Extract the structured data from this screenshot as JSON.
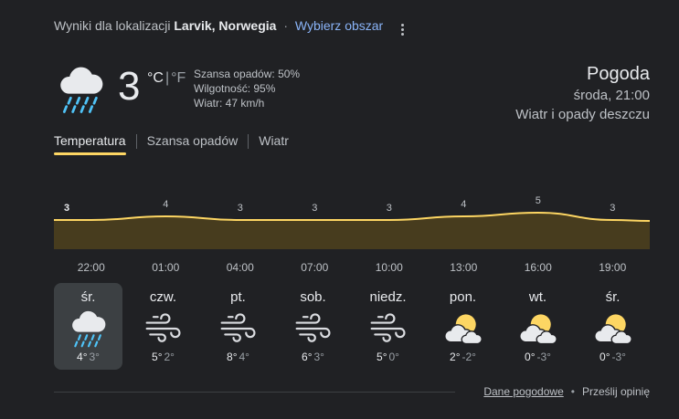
{
  "header": {
    "prefix": "Wyniki dla lokalizacji",
    "location": "Larvik, Norwegia",
    "separator": "·",
    "choose_area": "Wybierz obszar"
  },
  "current": {
    "icon": "rain-cloud-icon",
    "temperature": "3",
    "unit_c": "°C",
    "unit_sep": "|",
    "unit_f": "°F",
    "precip": "Szansa opadów: 50%",
    "humidity": "Wilgotność: 95%",
    "wind": "Wiatr: 47 km/h"
  },
  "summary": {
    "title": "Pogoda",
    "time": "środa, 21:00",
    "condition": "Wiatr i opady deszczu"
  },
  "tabs": [
    {
      "label": "Temperatura",
      "active": true
    },
    {
      "label": "Szansa opadów",
      "active": false
    },
    {
      "label": "Wiatr",
      "active": false
    }
  ],
  "chart_data": {
    "type": "area",
    "x": [
      "22:00",
      "01:00",
      "04:00",
      "07:00",
      "10:00",
      "13:00",
      "16:00",
      "19:00"
    ],
    "series": [
      {
        "values": [
          3,
          4,
          3,
          3,
          3,
          4,
          5,
          3
        ]
      }
    ],
    "data_labels": [
      "3",
      "4",
      "3",
      "3",
      "3",
      "4",
      "5",
      "3"
    ],
    "fill_color": "#473c1e",
    "line_color": "#fdd663"
  },
  "days": [
    {
      "name": "śr.",
      "icon": "rain-cloud-icon",
      "high": "4°",
      "low": "3°",
      "selected": true
    },
    {
      "name": "czw.",
      "icon": "wind-icon",
      "high": "5°",
      "low": "2°",
      "selected": false
    },
    {
      "name": "pt.",
      "icon": "wind-icon",
      "high": "8°",
      "low": "4°",
      "selected": false
    },
    {
      "name": "sob.",
      "icon": "wind-icon",
      "high": "6°",
      "low": "3°",
      "selected": false
    },
    {
      "name": "niedz.",
      "icon": "wind-icon",
      "high": "5°",
      "low": "0°",
      "selected": false
    },
    {
      "name": "pon.",
      "icon": "partly-cloudy-icon",
      "high": "2°",
      "low": "-2°",
      "selected": false
    },
    {
      "name": "wt.",
      "icon": "partly-cloudy-icon",
      "high": "0°",
      "low": "-3°",
      "selected": false
    },
    {
      "name": "śr.",
      "icon": "partly-cloudy-icon",
      "high": "0°",
      "low": "-3°",
      "selected": false
    }
  ],
  "footer": {
    "data_link": "Dane pogodowe",
    "dot": "•",
    "feedback": "Prześlij opinię"
  },
  "colors": {
    "background": "#202124",
    "accent": "#fdd663",
    "link": "#8ab4f8",
    "rain": "#4fc3f7"
  }
}
